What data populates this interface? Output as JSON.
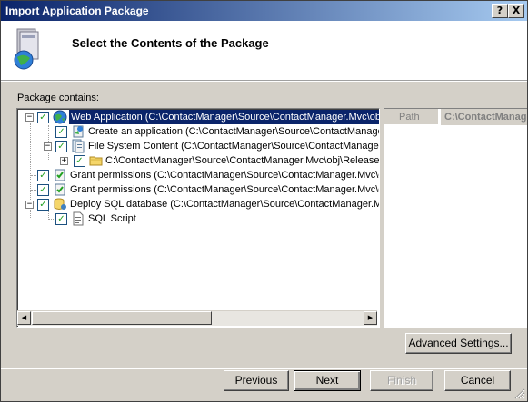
{
  "window": {
    "title": "Import Application Package",
    "help_glyph": "?",
    "close_glyph": "X"
  },
  "header": {
    "heading": "Select the Contents of the Package"
  },
  "package": {
    "label": "Package contains:"
  },
  "tree": {
    "nodes": [
      {
        "label": "Web Application (C:\\ContactManager\\Source\\ContactManager.Mvc\\obj\\Release\\Package\\PackageTmp)",
        "icon": "globe-icon",
        "expander": "−"
      },
      {
        "label": "Create an application (C:\\ContactManager\\Source\\ContactManager.Mvc\\obj\\Release\\Package\\PackageTmp)",
        "icon": "app-icon"
      },
      {
        "label": "File System Content (C:\\ContactManager\\Source\\ContactManager.Mvc\\obj\\Release\\Package\\PackageTmp)",
        "icon": "filesystem-icon",
        "expander": "−"
      },
      {
        "label": "C:\\ContactManager\\Source\\ContactManager.Mvc\\obj\\Release\\Package\\PackageTmp",
        "icon": "folder-icon",
        "expander": "+"
      },
      {
        "label": "Grant permissions (C:\\ContactManager\\Source\\ContactManager.Mvc\\obj\\Release\\Package\\PackageTmp)",
        "icon": "permissions-icon"
      },
      {
        "label": "Grant permissions (C:\\ContactManager\\Source\\ContactManager.Mvc\\obj\\Release\\Package\\PackageTmp)",
        "icon": "permissions-icon"
      },
      {
        "label": "Deploy SQL database (C:\\ContactManager\\Source\\ContactManager.Mvc\\obj\\Release\\Package\\PackageTmp)",
        "icon": "database-icon",
        "expander": "−"
      },
      {
        "label": "SQL Script",
        "icon": "script-icon"
      }
    ],
    "checked_glyph": "✓",
    "scroll_left_glyph": "◀",
    "scroll_right_glyph": "▶"
  },
  "properties": {
    "key": "Path",
    "value": "C:\\ContactManager\\Source\\ContactManager.Mvc\\obj\\Release\\Package\\PackageTmp"
  },
  "buttons": {
    "advanced": "Advanced Settings...",
    "previous": "Previous",
    "next": "Next",
    "finish": "Finish",
    "cancel": "Cancel"
  },
  "colors": {
    "title_start": "#0a246a",
    "title_end": "#a6caf0",
    "selection": "#0a246a",
    "dialog": "#d4d0c8"
  }
}
